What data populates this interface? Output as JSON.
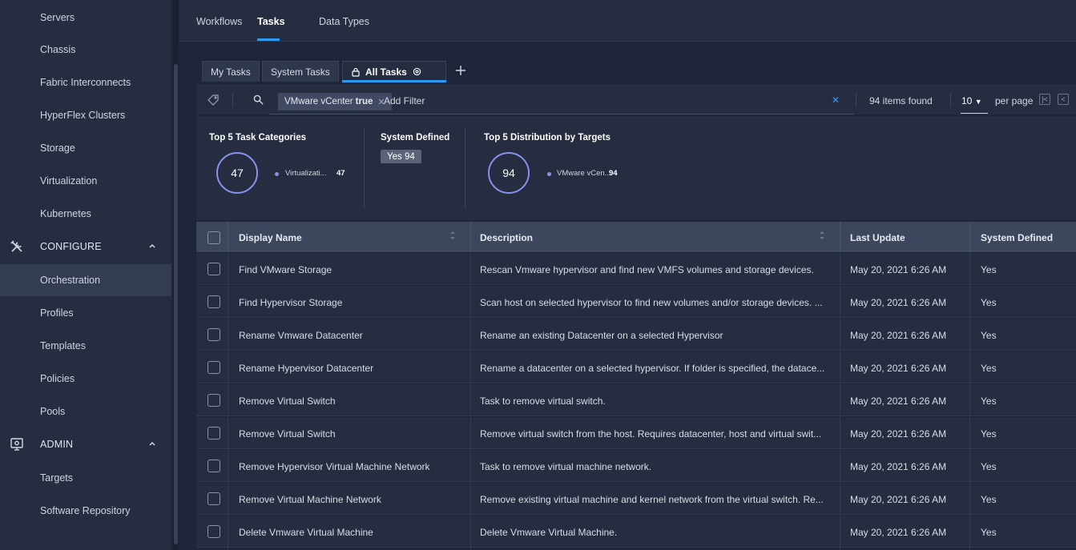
{
  "sidebar": {
    "items_top": [
      {
        "label": "Servers"
      },
      {
        "label": "Chassis"
      },
      {
        "label": "Fabric Interconnects"
      },
      {
        "label": "HyperFlex Clusters"
      },
      {
        "label": "Storage"
      },
      {
        "label": "Virtualization"
      },
      {
        "label": "Kubernetes"
      }
    ],
    "configure": {
      "label": "CONFIGURE",
      "items": [
        {
          "label": "Orchestration"
        },
        {
          "label": "Profiles"
        },
        {
          "label": "Templates"
        },
        {
          "label": "Policies"
        },
        {
          "label": "Pools"
        }
      ]
    },
    "admin": {
      "label": "ADMIN",
      "items": [
        {
          "label": "Targets"
        },
        {
          "label": "Software Repository"
        }
      ]
    }
  },
  "topnav": {
    "tabs": [
      {
        "label": "Workflows"
      },
      {
        "label": "Tasks"
      },
      {
        "label": "Data Types"
      }
    ]
  },
  "subtabs": [
    {
      "label": "My Tasks"
    },
    {
      "label": "System Tasks"
    },
    {
      "label": "All Tasks"
    }
  ],
  "filter": {
    "chip": "VMware vCenter",
    "chip_value": "true",
    "add_filter": "Add Filter",
    "items_found": "94 items found",
    "per_page_value": "10",
    "per_page_label": "per page"
  },
  "summary": {
    "categories": {
      "title": "Top 5 Task Categories",
      "total": "47",
      "legend_label": "Virtualizati...",
      "legend_value": "47"
    },
    "system_defined": {
      "title": "System Defined",
      "badge_label": "Yes",
      "badge_value": "94"
    },
    "targets": {
      "title": "Top 5 Distribution by Targets",
      "total": "94",
      "legend_label": "VMware vCen...",
      "legend_value": "94"
    }
  },
  "table": {
    "columns": [
      "Display Name",
      "Description",
      "Last Update",
      "System Defined"
    ],
    "rows": [
      [
        "Find VMware Storage",
        "Rescan Vmware hypervisor and find new VMFS volumes and storage devices.",
        "May 20, 2021 6:26 AM",
        "Yes"
      ],
      [
        "Find Hypervisor Storage",
        "Scan host on selected hypervisor to find new volumes and/or storage devices. ...",
        "May 20, 2021 6:26 AM",
        "Yes"
      ],
      [
        "Rename Vmware Datacenter",
        "Rename an existing Datacenter on a selected Hypervisor",
        "May 20, 2021 6:26 AM",
        "Yes"
      ],
      [
        "Rename Hypervisor Datacenter",
        "Rename a datacenter on a selected hypervisor. If folder is specified, the datace...",
        "May 20, 2021 6:26 AM",
        "Yes"
      ],
      [
        "Remove Virtual Switch",
        "Task to remove virtual switch.",
        "May 20, 2021 6:26 AM",
        "Yes"
      ],
      [
        "Remove Virtual Switch",
        "Remove virtual switch from the host. Requires datacenter, host and virtual swit...",
        "May 20, 2021 6:26 AM",
        "Yes"
      ],
      [
        "Remove Hypervisor Virtual Machine Network",
        "Task to remove virtual machine network.",
        "May 20, 2021 6:26 AM",
        "Yes"
      ],
      [
        "Remove Virtual Machine Network",
        "Remove existing virtual machine and kernel network from the virtual switch. Re...",
        "May 20, 2021 6:26 AM",
        "Yes"
      ],
      [
        "Delete Vmware Virtual Machine",
        "Delete Vmware Virtual Machine.",
        "May 20, 2021 6:26 AM",
        "Yes"
      ]
    ]
  },
  "colors": {
    "accent": "#2b9af3",
    "donut": "#8891ee",
    "background": "#1f2639",
    "panel": "#262d40"
  }
}
